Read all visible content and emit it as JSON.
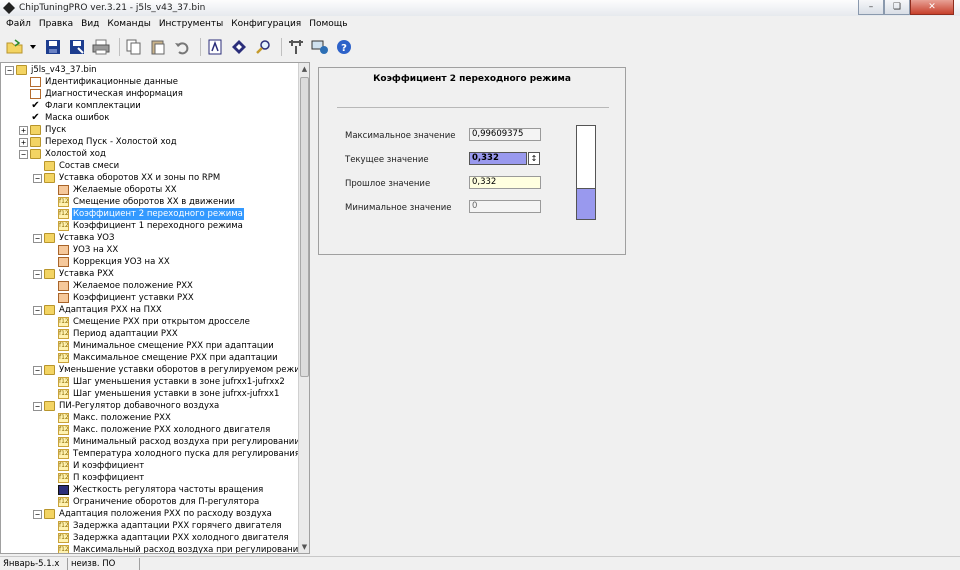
{
  "window": {
    "title": "ChipTuningPRO ver.3.21 - j5ls_v43_37.bin"
  },
  "menu": [
    "Файл",
    "Правка",
    "Вид",
    "Команды",
    "Инструменты",
    "Конфигурация",
    "Помощь"
  ],
  "toolbar": [
    "open-icon",
    "dropdown-icon",
    "save-icon",
    "save-as-icon",
    "print-icon",
    "copy-icon",
    "paste-icon",
    "undo-icon",
    "calc-icon",
    "diamond-icon",
    "search-icon",
    "tools-icon",
    "network-icon",
    "help-icon"
  ],
  "tree": [
    {
      "label": "j5ls_v43_37.bin",
      "level": 0,
      "icon": "folder",
      "exp": "-"
    },
    {
      "label": "Идентификационные данные",
      "level": 1,
      "icon": "doc"
    },
    {
      "label": "Диагностическая информация",
      "level": 1,
      "icon": "doc"
    },
    {
      "label": "Флаги комплектации",
      "level": 1,
      "icon": "check"
    },
    {
      "label": "Маска ошибок",
      "level": 1,
      "icon": "check"
    },
    {
      "label": "Пуск",
      "level": 1,
      "icon": "folder",
      "exp": "+"
    },
    {
      "label": "Переход Пуск - Холостой ход",
      "level": 1,
      "icon": "folder",
      "exp": "+"
    },
    {
      "label": "Холостой ход",
      "level": 1,
      "icon": "folder",
      "exp": "-"
    },
    {
      "label": "Состав смеси",
      "level": 2,
      "icon": "folder"
    },
    {
      "label": "Уставка оборотов ХХ и зоны по RPM",
      "level": 2,
      "icon": "folder",
      "exp": "-"
    },
    {
      "label": "Желаемые обороты ХХ",
      "level": 3,
      "icon": "table"
    },
    {
      "label": "Смещение оборотов ХХ в движении",
      "level": 3,
      "icon": "f12"
    },
    {
      "label": "Коэффициент 2 переходного режима",
      "level": 3,
      "icon": "f12",
      "selected": true
    },
    {
      "label": "Коэффициент 1 переходного режима",
      "level": 3,
      "icon": "f12"
    },
    {
      "label": "Уставка УОЗ",
      "level": 2,
      "icon": "folder",
      "exp": "-"
    },
    {
      "label": "УОЗ на ХХ",
      "level": 3,
      "icon": "table"
    },
    {
      "label": "Коррекция УОЗ на ХХ",
      "level": 3,
      "icon": "table"
    },
    {
      "label": "Уставка РХХ",
      "level": 2,
      "icon": "folder",
      "exp": "-"
    },
    {
      "label": "Желаемое положение РХХ",
      "level": 3,
      "icon": "table"
    },
    {
      "label": "Коэффициент уставки РХХ",
      "level": 3,
      "icon": "table"
    },
    {
      "label": "Адаптация РХХ на ПХХ",
      "level": 2,
      "icon": "folder",
      "exp": "-"
    },
    {
      "label": "Смещение РХХ при открытом дросселе",
      "level": 3,
      "icon": "f12"
    },
    {
      "label": "Период адаптации РХХ",
      "level": 3,
      "icon": "f12"
    },
    {
      "label": "Минимальное смещение РХХ при адаптации",
      "level": 3,
      "icon": "f12"
    },
    {
      "label": "Максимальное смещение РХХ при адаптации",
      "level": 3,
      "icon": "f12"
    },
    {
      "label": "Уменьшение уставки оборотов в регулируемом режиме",
      "level": 2,
      "icon": "folder",
      "exp": "-"
    },
    {
      "label": "Шаг уменьшения уставки в зоне jufrxx1-jufrxx2",
      "level": 3,
      "icon": "f12"
    },
    {
      "label": "Шаг уменьшения уставки в зоне jufrxx-jufrxx1",
      "level": 3,
      "icon": "f12"
    },
    {
      "label": "ПИ-Регулятор добавочного воздуха",
      "level": 2,
      "icon": "folder",
      "exp": "-"
    },
    {
      "label": "Макс. положение РХХ",
      "level": 3,
      "icon": "f12"
    },
    {
      "label": "Макс. положение РХХ холодного двигателя",
      "level": 3,
      "icon": "f12"
    },
    {
      "label": "Минимальный расход воздуха при регулировании",
      "level": 3,
      "icon": "f12"
    },
    {
      "label": "Температура холодного пуска для регулирования",
      "level": 3,
      "icon": "f12"
    },
    {
      "label": "И коэффициент",
      "level": 3,
      "icon": "f12"
    },
    {
      "label": "П коэффициент",
      "level": 3,
      "icon": "f12"
    },
    {
      "label": "Жесткость регулятора частоты вращения",
      "level": 3,
      "icon": "bits"
    },
    {
      "label": "Ограничение оборотов для П-регулятора",
      "level": 3,
      "icon": "f12"
    },
    {
      "label": "Адаптация положения РХХ по расходу воздуха",
      "level": 2,
      "icon": "folder",
      "exp": "-"
    },
    {
      "label": "Задержка адаптации РХХ горячего двигателя",
      "level": 3,
      "icon": "f12"
    },
    {
      "label": "Задержка адаптации РХХ холодного двигателя",
      "level": 3,
      "icon": "f12"
    },
    {
      "label": "Максимальный расход воздуха при регулировании",
      "level": 3,
      "icon": "f12"
    }
  ],
  "detail": {
    "title": "Коэффициент 2 переходного режима",
    "max_label": "Максимальное значение",
    "max_value": "0,99609375",
    "current_label": "Текущее значение",
    "current_value": "0,332",
    "prev_label": "Прошлое значение",
    "prev_value": "0,332",
    "min_label": "Минимальное значение",
    "min_value": "0",
    "level_fraction": 0.332
  },
  "status": {
    "cell1": "Январь-5.1.x",
    "cell2": "неизв. ПО"
  }
}
